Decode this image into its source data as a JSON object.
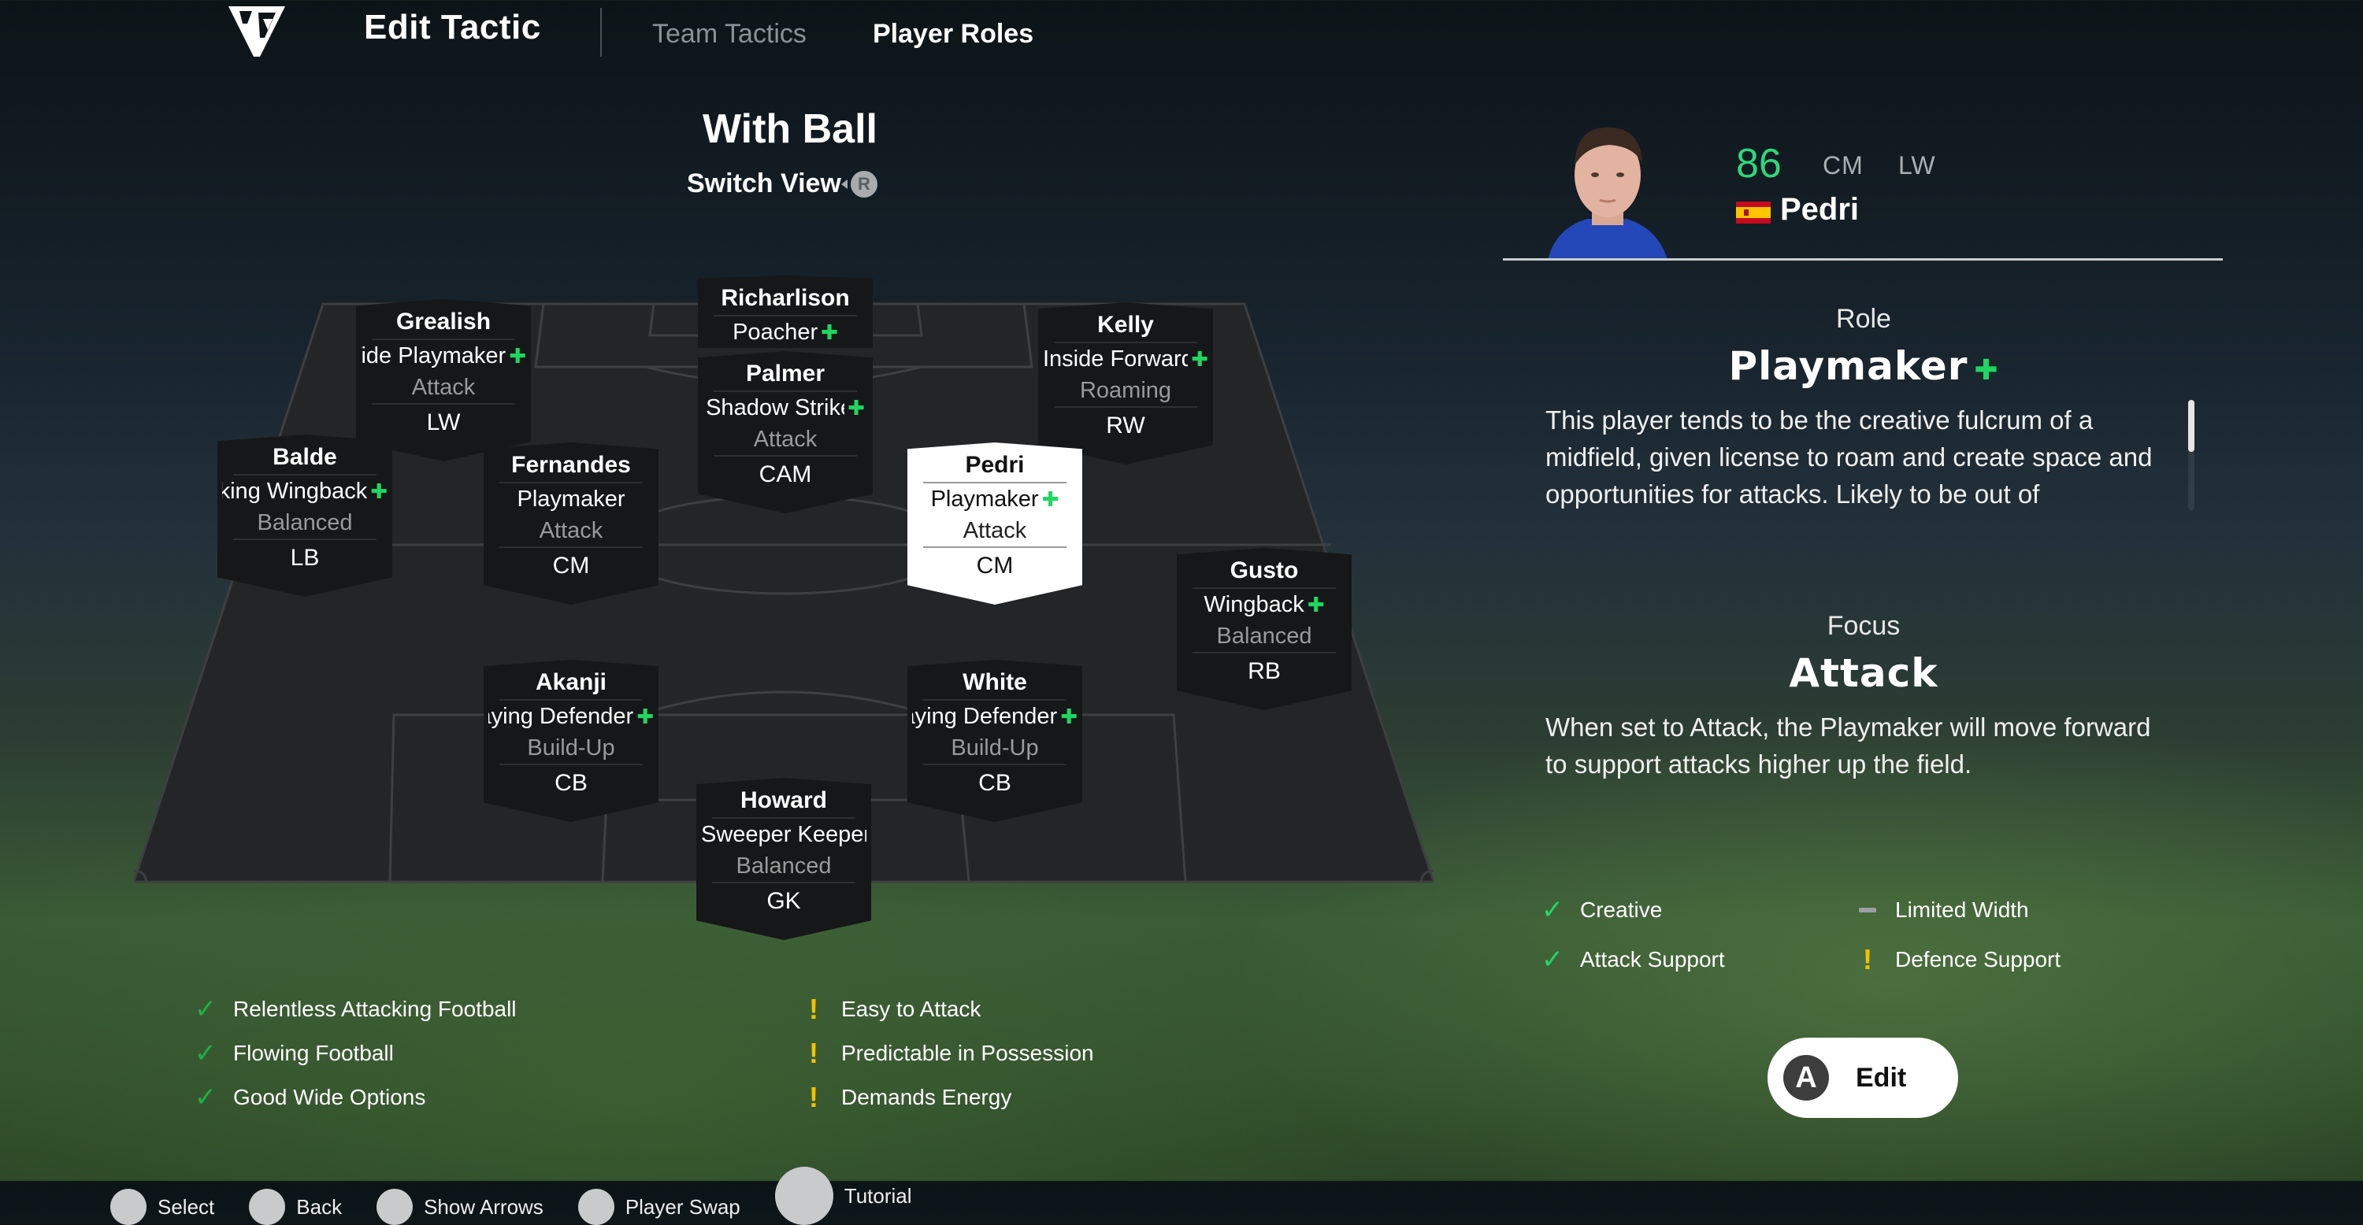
{
  "header": {
    "logo": "ea-sports-fc-logo",
    "title": "Edit Tactic",
    "tabs": [
      {
        "label": "Team Tactics",
        "active": false
      },
      {
        "label": "Player Roles",
        "active": true
      }
    ]
  },
  "view": {
    "title": "With Ball",
    "switch_label": "Switch View",
    "switch_button": "R"
  },
  "players": [
    {
      "name": "Richarlison",
      "role": "Poacher",
      "plus": true,
      "focus": "",
      "position": ""
    },
    {
      "name": "Grealish",
      "role": "Wide Playmaker",
      "plus": true,
      "focus": "Attack",
      "position": "LW"
    },
    {
      "name": "Kelly",
      "role": "Inside Forward",
      "plus": true,
      "focus": "Roaming",
      "position": "RW"
    },
    {
      "name": "Palmer",
      "role": "Shadow Striker",
      "plus": true,
      "focus": "Attack",
      "position": "CAM"
    },
    {
      "name": "Balde",
      "role": "Attacking Wingback",
      "plus": true,
      "focus": "Balanced",
      "position": "LB"
    },
    {
      "name": "Fernandes",
      "role": "Playmaker",
      "plus": false,
      "focus": "Attack",
      "position": "CM"
    },
    {
      "name": "Pedri",
      "role": "Playmaker",
      "plus": true,
      "focus": "Attack",
      "position": "CM",
      "selected": true
    },
    {
      "name": "Gusto",
      "role": "Wingback",
      "plus": true,
      "focus": "Balanced",
      "position": "RB"
    },
    {
      "name": "Akanji",
      "role": "Ball-Playing Defender",
      "plus": true,
      "focus": "Build-Up",
      "position": "CB"
    },
    {
      "name": "White",
      "role": "Ball-Playing Defender",
      "plus": true,
      "focus": "Build-Up",
      "position": "CB"
    },
    {
      "name": "Howard",
      "role": "Sweeper Keeper",
      "plus": false,
      "focus": "Balanced",
      "position": "GK"
    }
  ],
  "tactic_traits": {
    "strengths": [
      "Relentless Attacking Football",
      "Flowing Football",
      "Good Wide Options"
    ],
    "weaknesses": [
      "Easy to Attack",
      "Predictable in Possession",
      "Demands Energy"
    ]
  },
  "selected_player": {
    "rating": "86",
    "positions": [
      "CM",
      "LW"
    ],
    "nation": "Spain",
    "name": "Pedri",
    "role_label": "Role",
    "role": "Playmaker",
    "role_plus": true,
    "role_description": "This player tends to be the creative fulcrum of a midfield, given license to roam and create space and opportunities for attacks. Likely to be out of",
    "focus_label": "Focus",
    "focus": "Attack",
    "focus_description": "When set to Attack, the Playmaker will move forward to support attacks higher up the field.",
    "attributes": [
      {
        "label": "Creative",
        "type": "positive"
      },
      {
        "label": "Limited Width",
        "type": "neutral"
      },
      {
        "label": "Attack Support",
        "type": "positive"
      },
      {
        "label": "Defence Support",
        "type": "warning"
      }
    ]
  },
  "edit_button": {
    "key": "A",
    "label": "Edit"
  },
  "footer": [
    {
      "label": "Select"
    },
    {
      "label": "Back"
    },
    {
      "label": "Show Arrows"
    },
    {
      "label": "Player Swap"
    },
    {
      "label": "Tutorial"
    }
  ],
  "colors": {
    "positive": "#1fae4a",
    "plus": "#1fd760",
    "warning": "#f2c200",
    "rating": "#2fd67a"
  }
}
